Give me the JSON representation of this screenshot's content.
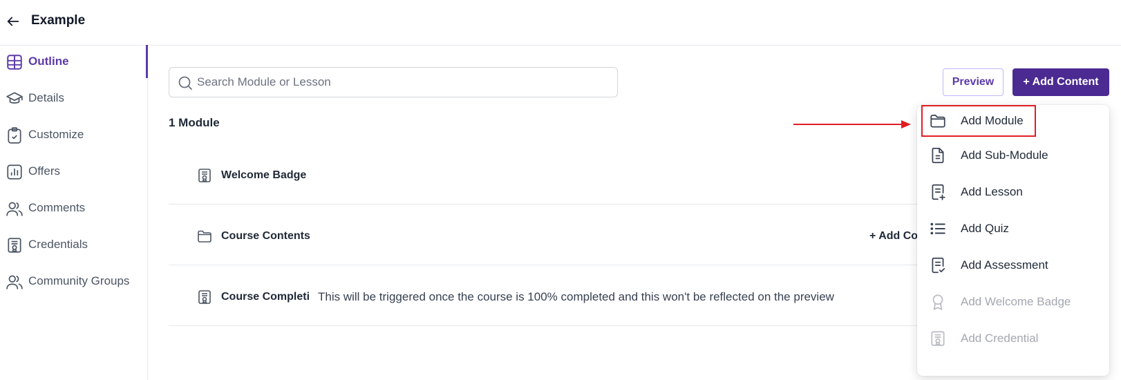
{
  "header": {
    "title": "Example"
  },
  "sidebar": {
    "items": [
      {
        "label": "Outline",
        "icon": "table-icon",
        "active": true
      },
      {
        "label": "Details",
        "icon": "graduation-cap-icon"
      },
      {
        "label": "Customize",
        "icon": "clipboard-check-icon"
      },
      {
        "label": "Offers",
        "icon": "bar-chart-icon"
      },
      {
        "label": "Comments",
        "icon": "users-icon"
      },
      {
        "label": "Credentials",
        "icon": "certificate-icon"
      },
      {
        "label": "Community Groups",
        "icon": "users-icon"
      }
    ]
  },
  "search": {
    "placeholder": "Search Module or Lesson",
    "value": ""
  },
  "actions": {
    "preview_label": "Preview",
    "add_content_label": "+ Add Content"
  },
  "outline": {
    "module_count": "1 Module",
    "rows": [
      {
        "title": "Welcome Badge",
        "icon": "certificate-icon",
        "note": "",
        "add_label": ""
      },
      {
        "title": "Course Contents",
        "icon": "folder-icon",
        "note": "",
        "add_label": "+ Add Co"
      },
      {
        "title": "Course Completi",
        "icon": "certificate-icon",
        "note": "This will be triggered once the course is 100% completed and this won't be reflected on the preview",
        "add_label": ""
      }
    ]
  },
  "dropdown": {
    "items": [
      {
        "label": "Add Module",
        "icon": "folder-icon",
        "disabled": false,
        "highlighted": true
      },
      {
        "label": "Add Sub-Module",
        "icon": "document-icon",
        "disabled": false
      },
      {
        "label": "Add Lesson",
        "icon": "document-plus-icon",
        "disabled": false
      },
      {
        "label": "Add Quiz",
        "icon": "list-icon",
        "disabled": false
      },
      {
        "label": "Add Assessment",
        "icon": "document-check-icon",
        "disabled": false
      },
      {
        "label": "Add Welcome Badge",
        "icon": "award-icon",
        "disabled": true
      },
      {
        "label": "Add Credential",
        "icon": "certificate-icon",
        "disabled": true
      }
    ]
  },
  "colors": {
    "accent": "#5b3aa8",
    "primary_button": "#4b2a91",
    "annotation": "#e11d24"
  }
}
